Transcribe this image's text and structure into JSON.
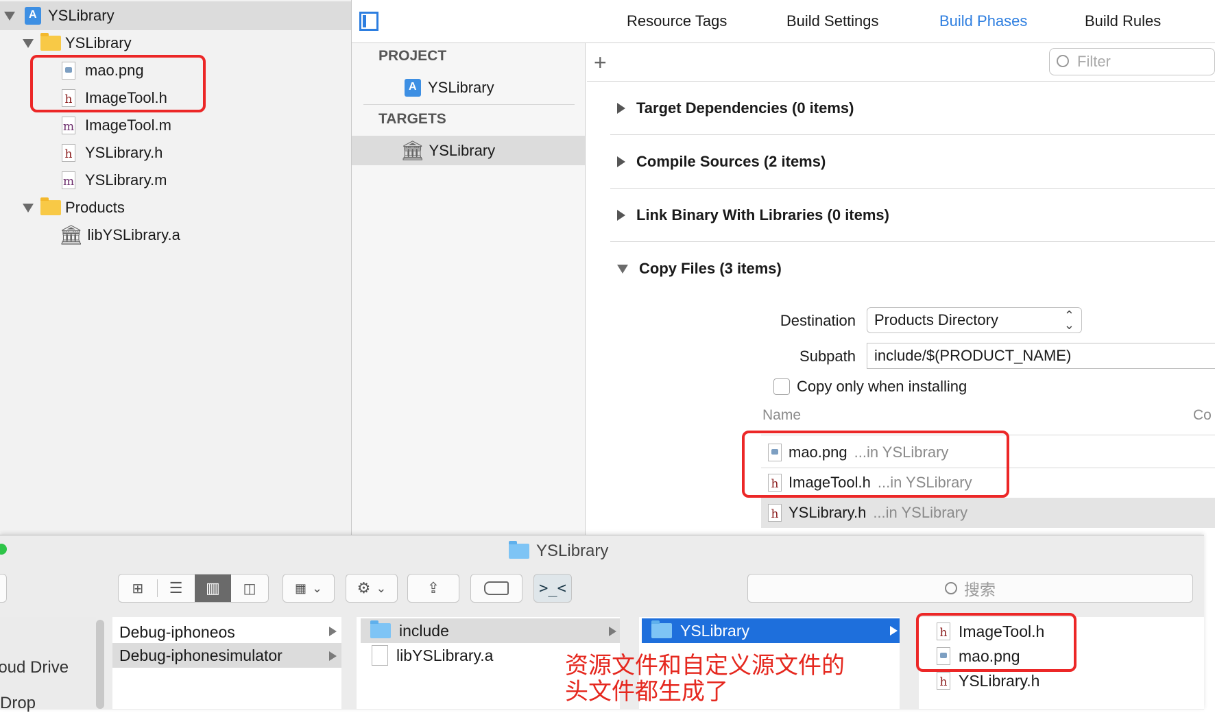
{
  "navigator": {
    "project": "YSLibrary",
    "group_yslibrary": "YSLibrary",
    "files": [
      "mao.png",
      "ImageTool.h",
      "ImageTool.m",
      "YSLibrary.h",
      "YSLibrary.m"
    ],
    "group_products": "Products",
    "product_file": "libYSLibrary.a"
  },
  "toolbar": {
    "tabs": [
      "Resource Tags",
      "Build Settings",
      "Build Phases",
      "Build Rules"
    ],
    "active_tab": "Build Phases",
    "filter_placeholder": "Filter",
    "add_label": "+"
  },
  "targets_pane": {
    "project_header": "PROJECT",
    "project_item": "YSLibrary",
    "targets_header": "TARGETS",
    "target_item": "YSLibrary"
  },
  "phases": {
    "target_dependencies": "Target Dependencies (0 items)",
    "compile_sources": "Compile Sources (2 items)",
    "link_binary": "Link Binary With Libraries (0 items)",
    "copy_files": "Copy Files (3 items)"
  },
  "copy_files": {
    "destination_label": "Destination",
    "destination_value": "Products Directory",
    "subpath_label": "Subpath",
    "subpath_value": "include/$(PRODUCT_NAME)",
    "copy_only_label": "Copy only when installing",
    "name_header": "Name",
    "code_header": "Co",
    "rows": [
      {
        "name": "mao.png",
        "location": "...in YSLibrary"
      },
      {
        "name": "ImageTool.h",
        "location": "...in YSLibrary"
      },
      {
        "name": "YSLibrary.h",
        "location": "...in YSLibrary"
      }
    ]
  },
  "finder": {
    "title": "YSLibrary",
    "search_placeholder": "搜索",
    "sidebar": [
      "loud Drive",
      "rDrop"
    ],
    "col1": [
      "Debug-iphoneos",
      "Debug-iphonesimulator"
    ],
    "col2": [
      "include",
      "libYSLibrary.a"
    ],
    "col3": [
      "YSLibrary"
    ],
    "col4": [
      "ImageTool.h",
      "mao.png",
      "YSLibrary.h"
    ]
  },
  "annotation": {
    "line1": "资源文件和自定义源文件的",
    "line2": "头文件都生成了"
  },
  "colors": {
    "accent": "#2d7ee0",
    "annotation_red": "#e5281f",
    "selection_blue": "#1e6fdc"
  }
}
